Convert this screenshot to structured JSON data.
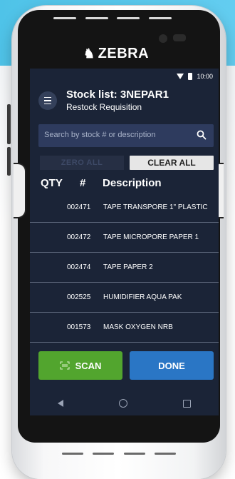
{
  "device": {
    "brand": "ZEBRA"
  },
  "status_bar": {
    "time": "10:00"
  },
  "header": {
    "title": "Stock list: 3NEPAR1",
    "subtitle": "Restock Requisition"
  },
  "search": {
    "placeholder": "Search by stock # or description"
  },
  "actions": {
    "zero_all": "ZERO ALL",
    "clear_all": "CLEAR ALL"
  },
  "table": {
    "columns": [
      "QTY",
      "#",
      "Description"
    ],
    "rows": [
      {
        "qty": "",
        "number": "002471",
        "description": "TAPE TRANSPORE 1\" PLASTIC"
      },
      {
        "qty": "",
        "number": "002472",
        "description": "TAPE MICROPORE PAPER 1"
      },
      {
        "qty": "",
        "number": "002474",
        "description": "TAPE PAPER 2"
      },
      {
        "qty": "",
        "number": "002525",
        "description": "HUMIDIFIER AQUA PAK"
      },
      {
        "qty": "",
        "number": "001573",
        "description": "MASK OXYGEN NRB"
      }
    ]
  },
  "footer": {
    "scan_label": "SCAN",
    "done_label": "DONE"
  },
  "colors": {
    "screen_bg": "#1b2437",
    "search_bg": "#2e3b5e",
    "scan_green": "#52a52e",
    "done_blue": "#2a76c5"
  }
}
